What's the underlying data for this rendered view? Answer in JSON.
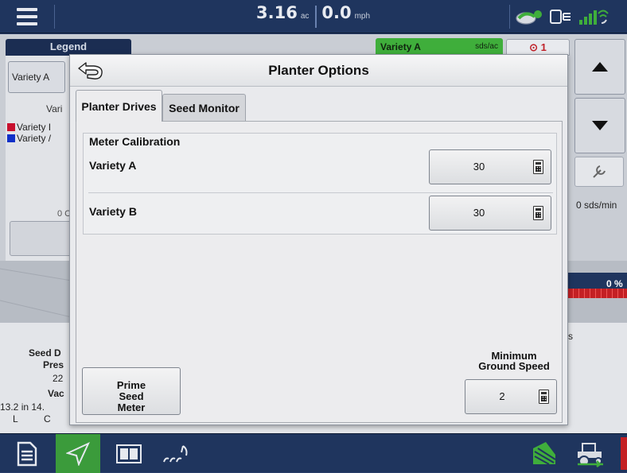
{
  "topbar": {
    "area_value": "3.16",
    "area_unit": "ac",
    "speed_value": "0.0",
    "speed_unit": "mph",
    "icons": [
      "menu-icon",
      "gps-rtk-icon",
      "display-link-icon",
      "wireless-signal-icon"
    ]
  },
  "background": {
    "legend_tab": "Legend",
    "variety_button": "Variety A",
    "legend_heading": "Vari",
    "legend_rows": [
      {
        "label": "Variety I",
        "color": "#c8102e"
      },
      {
        "label": "Variety /",
        "color": "#1030c8"
      }
    ],
    "legend_zero": "0 C",
    "banner_variety": "Variety A",
    "banner_unit": "sds/ac",
    "alarm_count": "1",
    "seed_rate": "0 sds/min",
    "percent": "0 %",
    "bottom_stats": {
      "seed_d": "Seed D",
      "pres": "Pres",
      "value_22": "22",
      "vac": "Vac",
      "spacing": "13.2 in 14.",
      "l": "L",
      "c": "C",
      "s": "s"
    }
  },
  "modal": {
    "title": "Planter Options",
    "tabs": [
      "Planter Drives",
      "Seed Monitor"
    ],
    "active_tab": "Planter Drives",
    "section_title": "Meter Calibration",
    "rows": [
      {
        "label": "Variety A",
        "value": "30"
      },
      {
        "label": "Variety B",
        "value": "30"
      }
    ],
    "prime_button": [
      "Prime",
      "Seed",
      "Meter"
    ],
    "min_speed_label": [
      "Minimum",
      "Ground Speed"
    ],
    "min_speed_value": "2"
  },
  "colors": {
    "topbar": "#1f355e",
    "accent_green": "#3b9b3b",
    "banner_green": "#3fae3b",
    "alarm_red": "#c0222a"
  },
  "bottombar": {
    "icons": [
      "document-icon",
      "navigation-arrow-icon",
      "split-view-icon",
      "plant-rows-icon",
      "field-operations-icon",
      "tractor-icon"
    ]
  }
}
